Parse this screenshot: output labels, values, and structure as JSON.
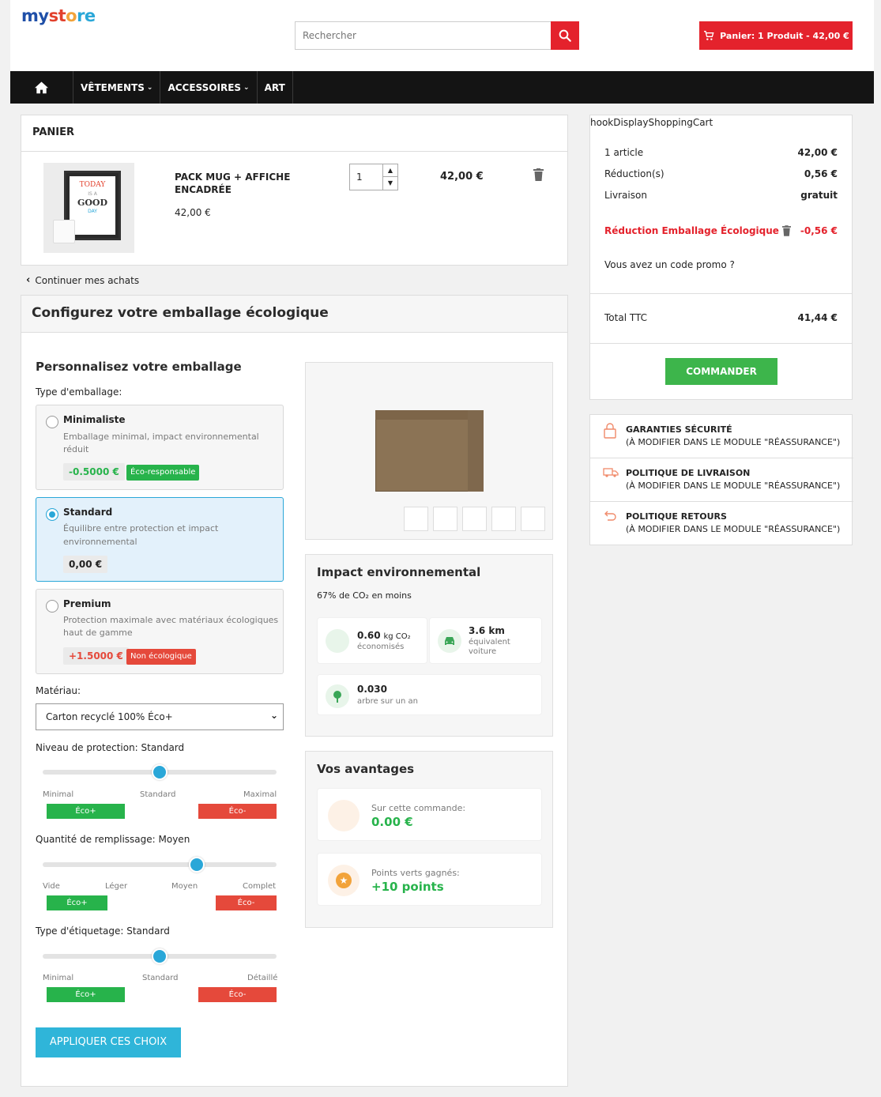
{
  "header": {
    "logo": {
      "part1": "my",
      "part2": "st",
      "part3": "o",
      "part4": "re"
    },
    "search_placeholder": "Rechercher",
    "cart_label": "Panier: 1 Produit - 42,00 €"
  },
  "nav": {
    "items": [
      {
        "label": "VÊTEMENTS"
      },
      {
        "label": "ACCESSOIRES"
      },
      {
        "label": "ART"
      }
    ]
  },
  "cart": {
    "title": "PANIER",
    "product": {
      "name": "PACK MUG + AFFICHE ENCADRÉE",
      "unit_price": "42,00 €",
      "quantity": "1",
      "total": "42,00 €",
      "poster_lines": [
        "TODAY",
        "IS A",
        "GOOD",
        "DAY"
      ]
    },
    "continue": "Continuer mes achats"
  },
  "packaging": {
    "title": "Configurez votre emballage écologique",
    "subtitle": "Personnalisez votre emballage",
    "type_label": "Type d'emballage:",
    "options": [
      {
        "name": "Minimaliste",
        "desc": "Emballage minimal, impact environnemental réduit",
        "price": "-0.5000 €",
        "tag": "Éco-responsable",
        "selected": false
      },
      {
        "name": "Standard",
        "desc": "Équilibre entre protection et impact environnemental",
        "price": "0,00 €",
        "tag": "",
        "selected": true
      },
      {
        "name": "Premium",
        "desc": "Protection maximale avec matériaux écologiques haut de gamme",
        "price": "+1.5000 €",
        "tag": "Non écologique",
        "selected": false
      }
    ],
    "material_label": "Matériau:",
    "material_value": "Carton recyclé 100% Éco+",
    "protection": {
      "label": "Niveau de protection: Standard",
      "ticks": [
        "Minimal",
        "Standard",
        "Maximal"
      ],
      "value": 0.5,
      "eco_plus": "Éco+",
      "eco_minus": "Éco-"
    },
    "filling": {
      "label": "Quantité de remplissage: Moyen",
      "ticks": [
        "Vide",
        "Léger",
        "Moyen",
        "Complet"
      ],
      "value": 0.66,
      "eco_plus": "Éco+",
      "eco_minus": "Éco-"
    },
    "labeling": {
      "label": "Type d'étiquetage: Standard",
      "ticks": [
        "Minimal",
        "Standard",
        "Détaillé"
      ],
      "value": 0.5,
      "eco_plus": "Éco+",
      "eco_minus": "Éco-"
    },
    "apply_button": "APPLIQUER CES CHOIX"
  },
  "impact": {
    "title": "Impact environnemental",
    "summary": "67% de CO₂ en moins",
    "co2_value": "0.60",
    "co2_unit": "kg CO₂",
    "co2_label": "économisés",
    "km_value": "3.6 km",
    "km_label": "équivalent voiture",
    "tree_value": "0.030",
    "tree_label": "arbre sur un an"
  },
  "advantages": {
    "title": "Vos avantages",
    "order_label": "Sur cette commande:",
    "order_value": "0.00 €",
    "points_label": "Points verts gagnés:",
    "points_value": "+10 points"
  },
  "summary": {
    "hook": "hookDisplayShoppingCart",
    "articles_label": "1 article",
    "articles_value": "42,00 €",
    "reduction_label": "Réduction(s)",
    "reduction_value": "0,56 €",
    "shipping_label": "Livraison",
    "shipping_value": "gratuit",
    "eco_label": "Réduction Emballage Écologique",
    "eco_value": "-0,56 €",
    "promo": "Vous avez un code promo ?",
    "total_label": "Total TTC",
    "total_value": "41,44 €",
    "order_button": "COMMANDER"
  },
  "reassurance": [
    {
      "title": "GARANTIES SÉCURITÉ",
      "sub": "(À MODIFIER DANS LE MODULE \"RÉASSURANCE\")"
    },
    {
      "title": "POLITIQUE DE LIVRAISON",
      "sub": "(À MODIFIER DANS LE MODULE \"RÉASSURANCE\")"
    },
    {
      "title": "POLITIQUE RETOURS",
      "sub": "(À MODIFIER DANS LE MODULE \"RÉASSURANCE\")"
    }
  ],
  "colors": {
    "primary_red": "#e4222c",
    "accent_blue": "#2aa7d8",
    "eco_green": "#27b34b",
    "eco_red": "#e5493b",
    "nav_bg": "#141414"
  }
}
